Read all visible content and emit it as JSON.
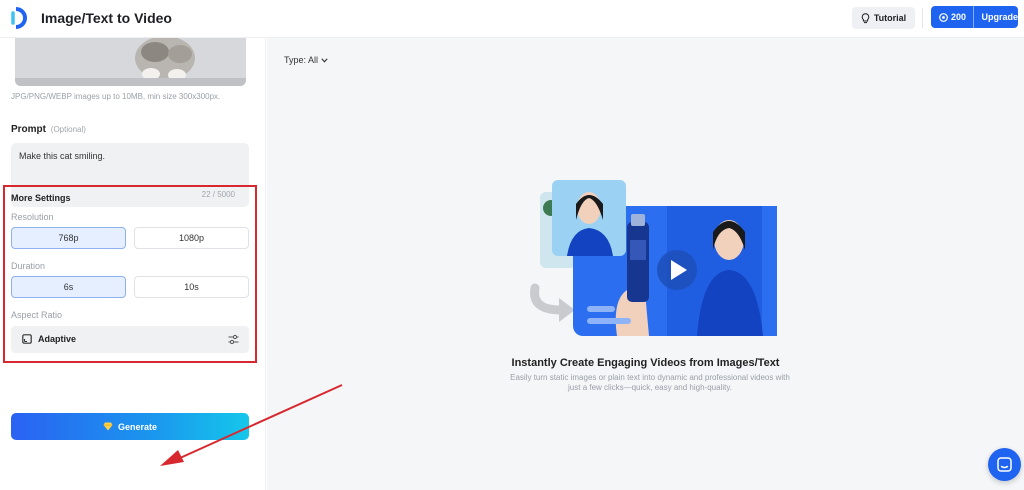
{
  "header": {
    "title": "Image/Text to Video",
    "tutorial_label": "Tutorial",
    "credits": "200",
    "upgrade_label": "Upgrade"
  },
  "sidebar": {
    "file_hint": "JPG/PNG/WEBP images up to 10MB, min size 300x300px.",
    "prompt": {
      "label": "Prompt",
      "optional": "(Optional)",
      "value": "Make this cat smiling.",
      "count": "22 / 5000"
    },
    "settings": {
      "title": "More Settings",
      "resolution_label": "Resolution",
      "resolution_options": [
        "768p",
        "1080p"
      ],
      "resolution_selected": "768p",
      "duration_label": "Duration",
      "duration_options": [
        "6s",
        "10s"
      ],
      "duration_selected": "6s",
      "aspect_label": "Aspect Ratio",
      "aspect_value": "Adaptive"
    },
    "generate_label": "Generate"
  },
  "main": {
    "type_filter": "Type: All",
    "empty_title": "Instantly Create Engaging Videos from Images/Text",
    "empty_desc": "Easily turn static images or plain text into dynamic and professional videos with just a few clicks—quick, easy and high-quality."
  },
  "colors": {
    "accent": "#1e64f0",
    "annotation": "#d7282f",
    "selected_bg": "#e6efff"
  },
  "icons": {
    "logo": "brand-logo-icon",
    "tutorial": "lightbulb-icon",
    "credits": "coin-icon",
    "filter": "chevron-down-icon",
    "aspect": "aspect-ratio-icon",
    "aspect_settings": "sliders-icon",
    "generate": "gem-icon",
    "chat": "chat-icon"
  }
}
